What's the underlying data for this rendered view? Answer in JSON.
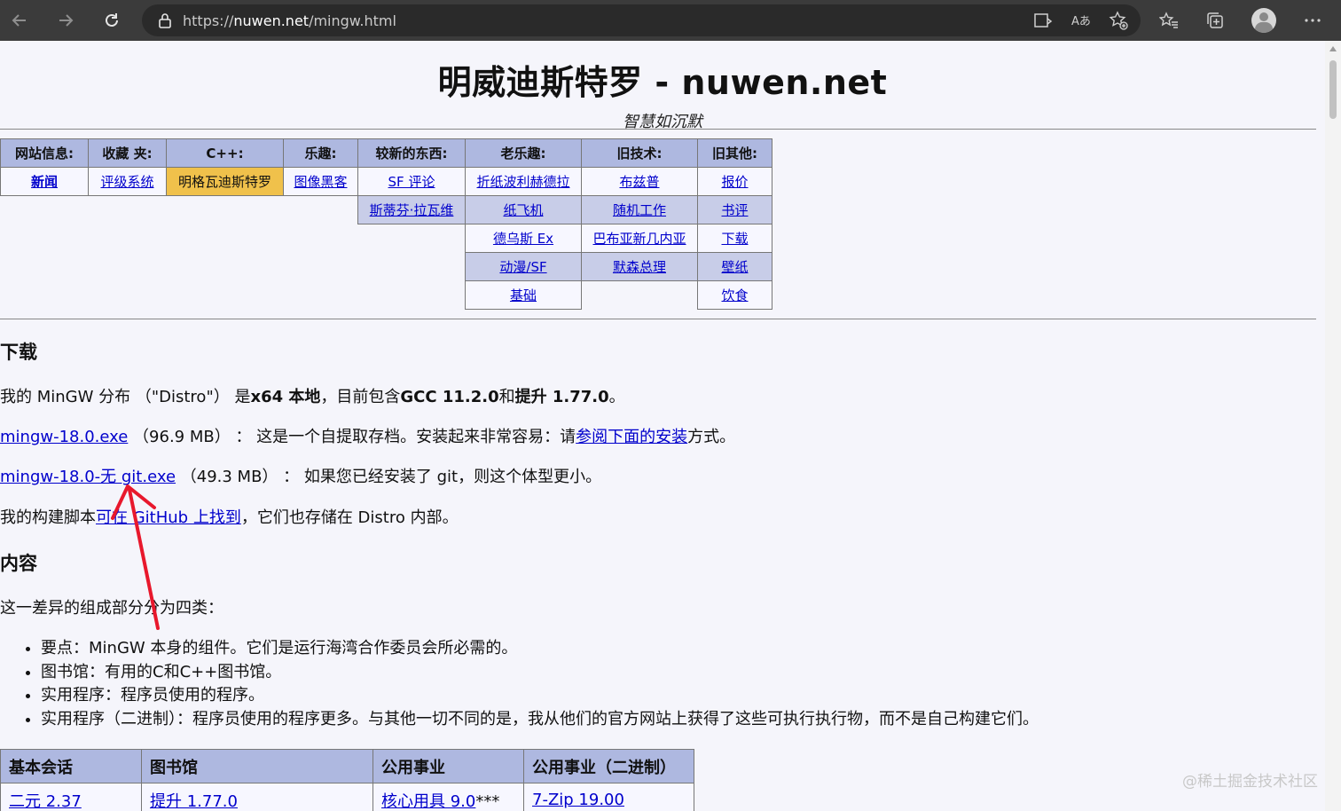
{
  "browser": {
    "url_prefix": "https://",
    "url_host": "nuwen.net",
    "url_path": "/mingw.html"
  },
  "site": {
    "title": "明威迪斯特罗 - nuwen.net",
    "subtitle": "智慧如沉默"
  },
  "nav": {
    "headers": [
      "网站信息:",
      "收藏 夹:",
      "C++:",
      "乐趣:",
      "较新的东西:",
      "老乐趣:",
      "旧技术:",
      "旧其他:"
    ],
    "row1": [
      "新闻",
      "评级系统",
      "明格瓦迪斯特罗",
      "图像黑客",
      "SF 评论",
      "折纸波利赫德拉",
      "布兹普",
      "报价"
    ],
    "row2": [
      "斯蒂芬·拉瓦维",
      "纸飞机",
      "随机工作",
      "书评"
    ],
    "row3": [
      "德乌斯 Ex",
      "巴布亚新几内亚",
      "下载"
    ],
    "row4": [
      "动漫/SF",
      "默森总理",
      "壁纸"
    ],
    "row5": [
      "基础",
      "饮食"
    ]
  },
  "content": {
    "download_heading": "下载",
    "distro_intro": {
      "a": "我的 MinGW 分布 （\"Distro\"） 是",
      "b": "x64 本地",
      "c": "，目前包含",
      "d": "GCC 11.2.0",
      "e": "和",
      "f": "提升 1.77.0",
      "g": "。"
    },
    "dl1": {
      "link": "mingw-18.0.exe",
      "size": " （96.9 MB） ： 这是一个自提取存档。安装起来非常容易：请",
      "link2": "参阅下面的安装",
      "tail": "方式。"
    },
    "dl2": {
      "link": "mingw-18.0-无 git.exe",
      "text": " （49.3 MB） ： 如果您已经安装了 git，则这个体型更小。"
    },
    "build": {
      "a": "我的构建脚本",
      "link": "可在 GitHub 上找到",
      "b": "，它们也存储在 Distro 内部。"
    },
    "contents_heading": "内容",
    "intro": "这一差异的组成部分分为四类：",
    "bullets": [
      "要点：MinGW 本身的组件。它们是运行海湾合作委员会所必需的。",
      "图书馆：有用的C和C++图书馆。",
      "实用程序：程序员使用的程序。",
      "实用程序（二进制）：程序员使用的程序更多。与其他一切不同的是，我从他们的官方网站上获得了这些可执行执行物，而不是自己构建它们。"
    ]
  },
  "packages": {
    "headers": [
      "基本会话",
      "图书馆",
      "公用事业",
      "公用事业（二进制）"
    ],
    "row1": [
      "二元 2.37",
      "提升 1.77.0",
      "核心用具 9.0",
      "7-Zip 19.00"
    ],
    "row1_suffix": "***"
  },
  "watermark": "@稀土掘金技术社区",
  "colors": {
    "nav_header": "#aeb8e0",
    "active_cell": "#f0c14b",
    "link": "#0000cc",
    "annotation_arrow": "#e8182c"
  }
}
